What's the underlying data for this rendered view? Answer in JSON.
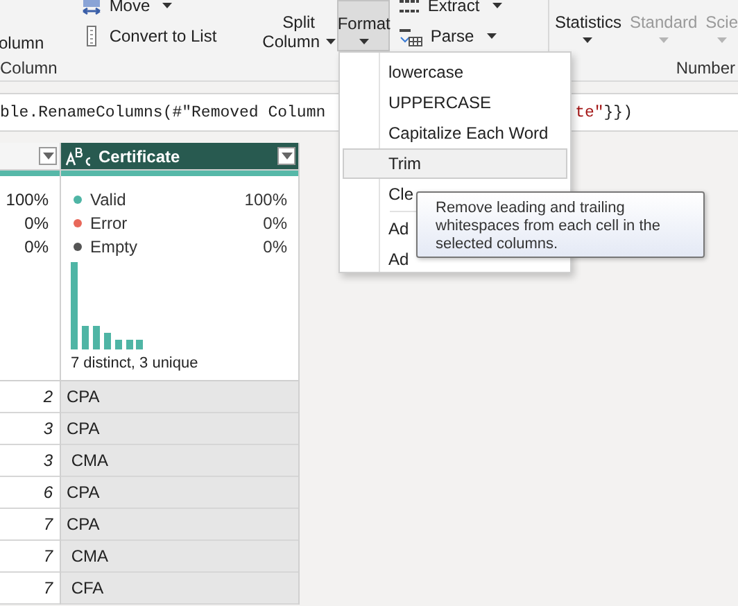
{
  "ribbon": {
    "partial_button": "olumn",
    "small_buttons": [
      {
        "label": "Move",
        "dropdown": true
      },
      {
        "label": "Convert to List",
        "dropdown": false
      }
    ],
    "split_button": {
      "lines": [
        "Split",
        "Column"
      ],
      "dropdown": true
    },
    "format_button": {
      "label": "Format",
      "pressed": true,
      "dropdown": true
    },
    "text_buttons": [
      {
        "label": "Extract",
        "dropdown": true
      },
      {
        "label": "Parse",
        "dropdown": true
      }
    ],
    "number_buttons": [
      {
        "label": "Statistics",
        "disabled": false
      },
      {
        "label": "Standard",
        "disabled": true
      },
      {
        "label": "Scie",
        "disabled": true
      }
    ],
    "group_labels": [
      "Column",
      "Number"
    ]
  },
  "formula": {
    "left": "ble.RenameColumns(#\"Removed Column",
    "right": [
      {
        "text": "te\"",
        "kind": "string"
      },
      {
        "text": "}})",
        "kind": "code"
      }
    ]
  },
  "columns": [
    {
      "profile": [
        {
          "value": "100%"
        },
        {
          "value": "0%"
        },
        {
          "value": "0%"
        }
      ]
    },
    {
      "name": "Certificate",
      "selected": true,
      "profile": [
        {
          "label": "Valid",
          "value": "100%",
          "color": "#4fb5a5"
        },
        {
          "label": "Error",
          "value": "0%",
          "color": "#e8685a"
        },
        {
          "label": "Empty",
          "value": "0%",
          "color": "#555555"
        }
      ],
      "summary": "7 distinct, 3 unique"
    }
  ],
  "rows": [
    {
      "col_1": "2",
      "certificate": "CPA"
    },
    {
      "col_1": "3",
      "certificate": "CPA"
    },
    {
      "col_1": "3",
      "certificate": " CMA"
    },
    {
      "col_1": "6",
      "certificate": "CPA"
    },
    {
      "col_1": "7",
      "certificate": "CPA"
    },
    {
      "col_1": "7",
      "certificate": " CMA"
    },
    {
      "col_1": "7",
      "certificate": " CFA"
    }
  ],
  "format_menu": {
    "items": [
      {
        "label": "lowercase",
        "selected": false
      },
      {
        "label": "UPPERCASE",
        "selected": false
      },
      {
        "label": "Capitalize Each Word",
        "selected": false
      },
      {
        "label": "Trim",
        "selected": true
      },
      {
        "label": "Cle",
        "selected": false
      },
      {
        "label": "Ad",
        "selected": false
      },
      {
        "label": "Ad",
        "selected": false
      }
    ]
  },
  "tooltip": "Remove leading and trailing whitespaces from each cell in the selected columns."
}
